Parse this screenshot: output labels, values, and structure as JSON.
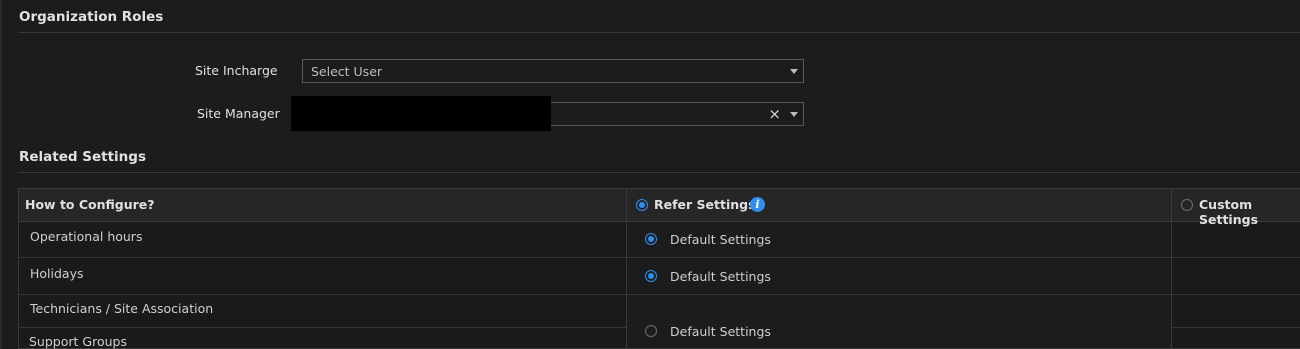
{
  "org_roles": {
    "title": "Organization Roles",
    "site_incharge": {
      "label": "Site Incharge",
      "placeholder": "Select User"
    },
    "site_manager": {
      "label": "Site Manager",
      "value": "",
      "clear_glyph": "×"
    }
  },
  "related": {
    "title": "Related Settings",
    "header": {
      "col1": "How to Configure?",
      "refer": "Refer Settings",
      "info_glyph": "i",
      "custom": "Custom Settings"
    },
    "rows": [
      {
        "name": "Operational hours",
        "option": "Default Settings",
        "selected": true
      },
      {
        "name": "Holidays",
        "option": "Default Settings",
        "selected": true
      },
      {
        "name": "Technicians / Site Association",
        "option": "",
        "selected": false
      },
      {
        "name": "Support Groups",
        "option": "Default Settings",
        "selected": false
      }
    ]
  }
}
